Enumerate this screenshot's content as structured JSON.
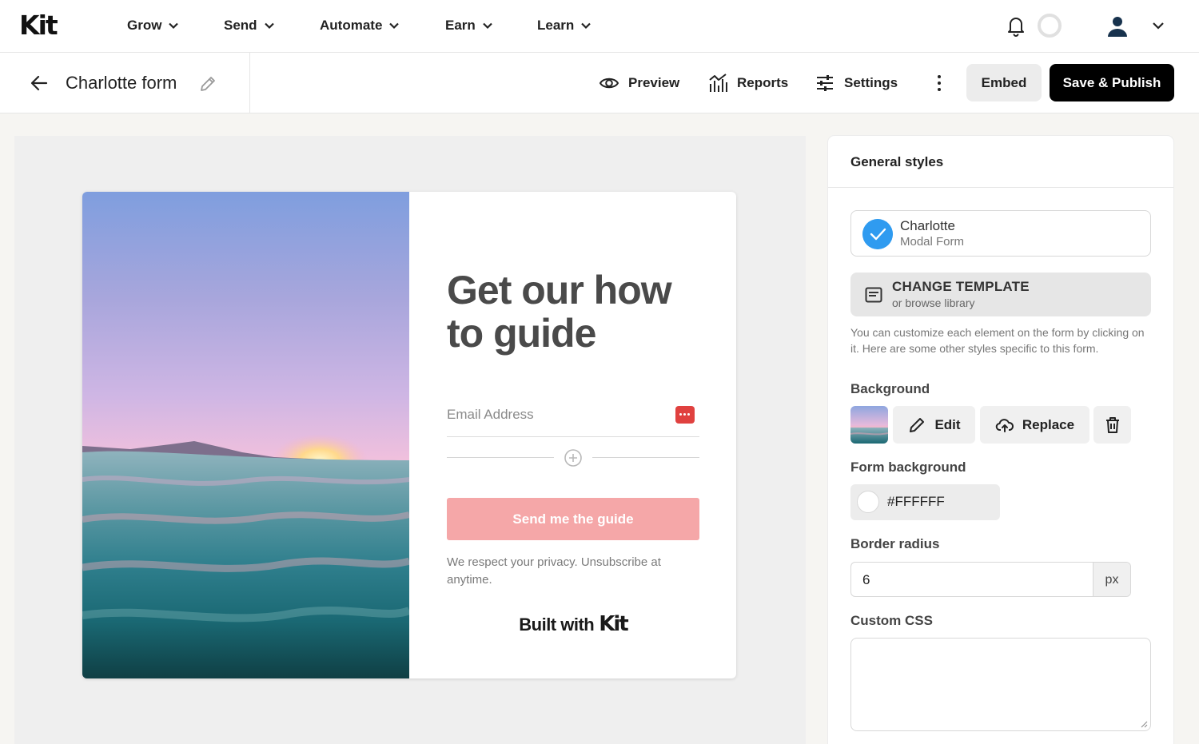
{
  "brand": {
    "logo_text": "Kit"
  },
  "nav": {
    "items": [
      {
        "label": "Grow"
      },
      {
        "label": "Send"
      },
      {
        "label": "Automate"
      },
      {
        "label": "Earn"
      },
      {
        "label": "Learn"
      }
    ],
    "icons": [
      "bell-icon",
      "status-ring-icon",
      "avatar-icon",
      "chevron-down-icon"
    ]
  },
  "toolbar": {
    "form_name": "Charlotte form",
    "preview_label": "Preview",
    "reports_label": "Reports",
    "settings_label": "Settings",
    "embed_label": "Embed",
    "publish_label": "Save & Publish"
  },
  "form_preview": {
    "headline": "Get our how to guide",
    "email_placeholder": "Email Address",
    "submit_label": "Send me the guide",
    "privacy_text": "We respect your privacy. Unsubscribe at anytime.",
    "built_with": "Built with",
    "built_with_brand": "Kit",
    "submit_color": "#f5a7a8"
  },
  "panel": {
    "title": "General styles",
    "template": {
      "name": "Charlotte",
      "type": "Modal Form"
    },
    "change_template": {
      "title": "CHANGE TEMPLATE",
      "subtitle": "or browse library"
    },
    "hint": "You can customize each element on the form by clicking on it. Here are some other styles specific to this form.",
    "background": {
      "label": "Background",
      "edit_label": "Edit",
      "replace_label": "Replace"
    },
    "form_background": {
      "label": "Form background",
      "value": "#FFFFFF"
    },
    "border_radius": {
      "label": "Border radius",
      "value": "6",
      "unit": "px"
    },
    "custom_css": {
      "label": "Custom CSS",
      "value": ""
    }
  },
  "colors": {
    "accent_blue": "#2f9bf0",
    "publish_bg": "#000000",
    "email_icon_red": "#e0413f"
  }
}
